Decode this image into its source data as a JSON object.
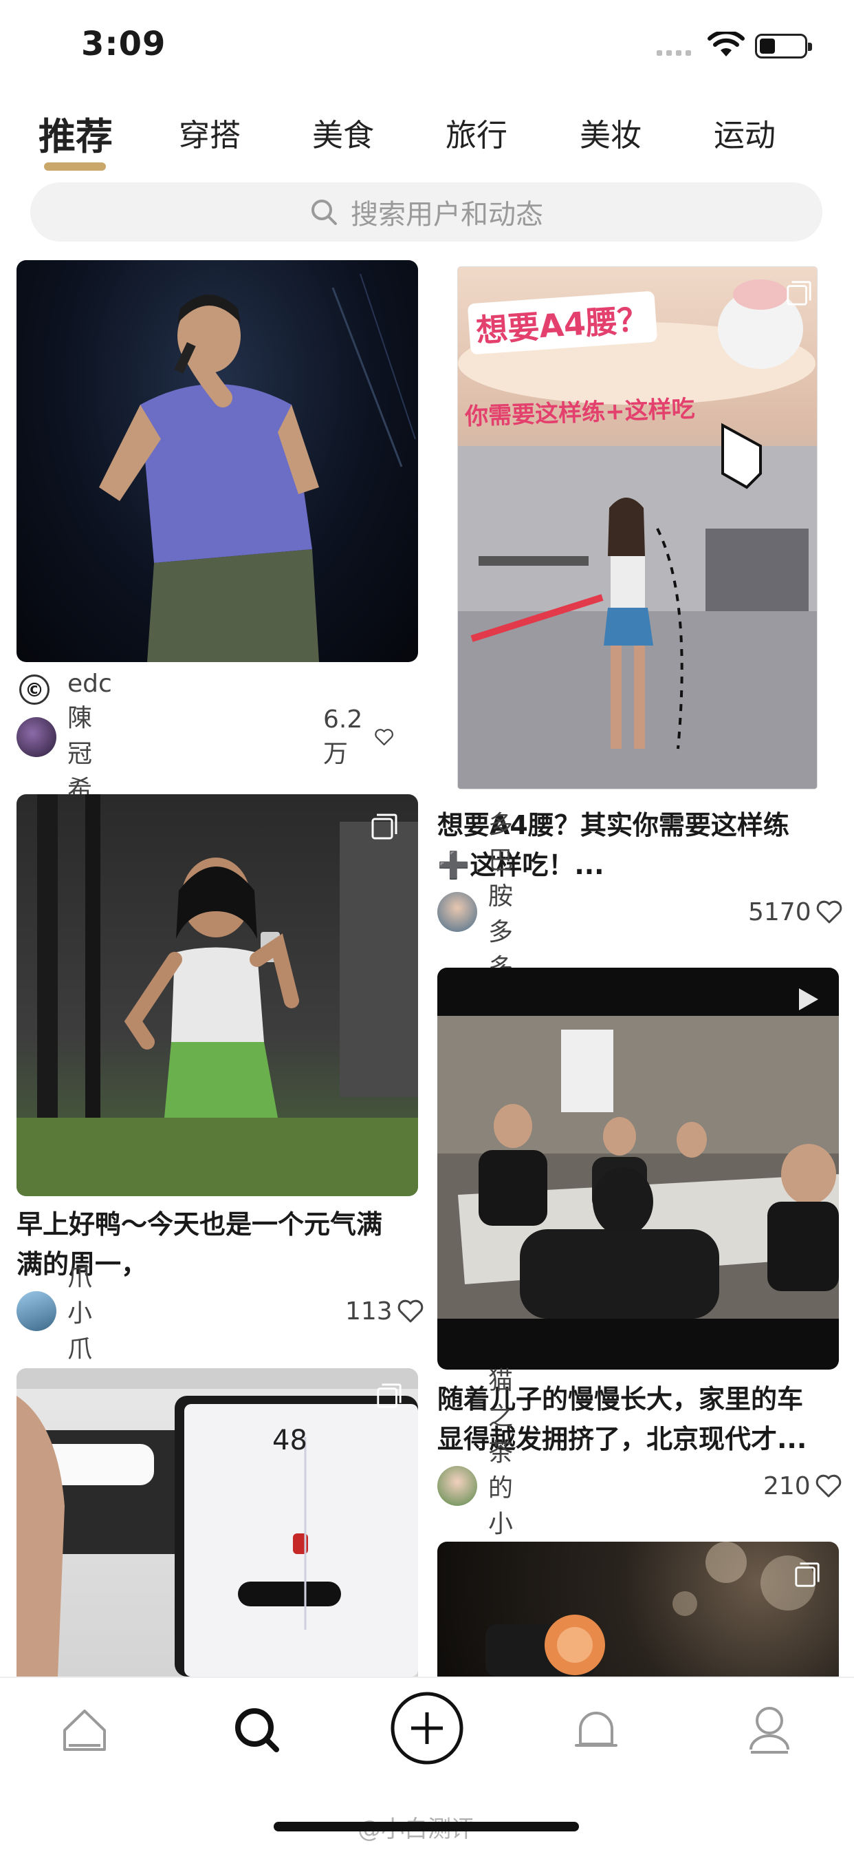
{
  "status_bar": {
    "time": "3:09"
  },
  "tabs": [
    {
      "label": "推荐",
      "active": true
    },
    {
      "label": "穿搭",
      "active": false
    },
    {
      "label": "美食",
      "active": false
    },
    {
      "label": "旅行",
      "active": false
    },
    {
      "label": "美妆",
      "active": false
    },
    {
      "label": "运动",
      "active": false
    }
  ],
  "search": {
    "placeholder": "搜索用户和动态"
  },
  "feed": {
    "left": [
      {
        "copyright_mark": "©",
        "author": "edc陳冠希",
        "likes": "6.2万"
      },
      {
        "title_line1": "早上好鸭～今天也是一个元气满",
        "title_line2": "满的周一，",
        "author": "爪小爪",
        "likes": "113"
      },
      {
        "screen_speed": "48"
      }
    ],
    "right": [
      {
        "image_text_top": "想要A4腰？",
        "image_text_mid": "你需要这样练+这样吃",
        "title_line1": "想要A4腰？其实你需要这样练",
        "title_line2": "➕这样吃！...",
        "author": "多巴胺多多酱",
        "likes": "5170"
      },
      {
        "title_line1": "随着儿子的慢慢长大，家里的车",
        "title_line2": "显得越发拥挤了，北京现代才...",
        "author": "猫之茶的小幸福",
        "likes": "210"
      },
      {}
    ]
  },
  "bottom_nav": [
    {
      "icon": "home-icon"
    },
    {
      "icon": "discover-icon",
      "active": true
    },
    {
      "icon": "add-post-icon"
    },
    {
      "icon": "notification-bell-icon"
    },
    {
      "icon": "profile-icon"
    }
  ],
  "watermark": "@小白测评",
  "colors": {
    "accent": "#c9a76b",
    "text": "#1a1a1a",
    "muted": "#9a9a9a"
  }
}
